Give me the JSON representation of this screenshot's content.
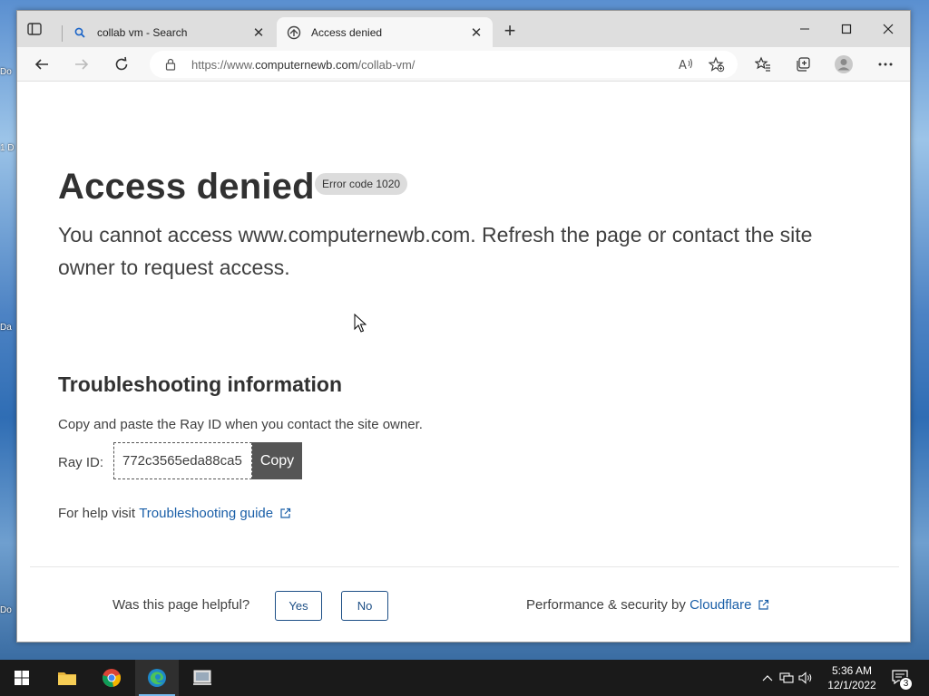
{
  "desktop": {
    "fragments": [
      "Do",
      "1 D",
      "Da",
      "Do"
    ]
  },
  "browser": {
    "tabs": [
      {
        "title": "collab vm - Search",
        "icon": "search-icon",
        "active": false
      },
      {
        "title": "Access denied",
        "icon": "cloudflare-favicon",
        "active": true
      }
    ],
    "address": {
      "prefix": "https://www.",
      "domain": "computernewb.com",
      "path": "/collab-vm/"
    }
  },
  "page": {
    "heading": "Access denied",
    "error_badge": "Error code 1020",
    "lead": "You cannot access www.computernewb.com. Refresh the page or contact the site owner to request access.",
    "troubleshooting_heading": "Troubleshooting information",
    "copy_instruction": "Copy and paste the Ray ID when you contact the site owner.",
    "ray_label": "Ray ID:",
    "ray_id": "772c3565eda88ca5",
    "copy_label": "Copy",
    "help_prefix": "For help visit ",
    "help_link": "Troubleshooting guide",
    "helpful_question": "Was this page helpful?",
    "yes_label": "Yes",
    "no_label": "No",
    "perf_prefix": "Performance & security by ",
    "perf_link": "Cloudflare"
  },
  "taskbar": {
    "time": "5:36 AM",
    "date": "12/1/2022",
    "notification_count": "3"
  },
  "colors": {
    "link": "#1a5fa8",
    "button_border": "#1d4f86",
    "copy_bg": "#555555"
  }
}
